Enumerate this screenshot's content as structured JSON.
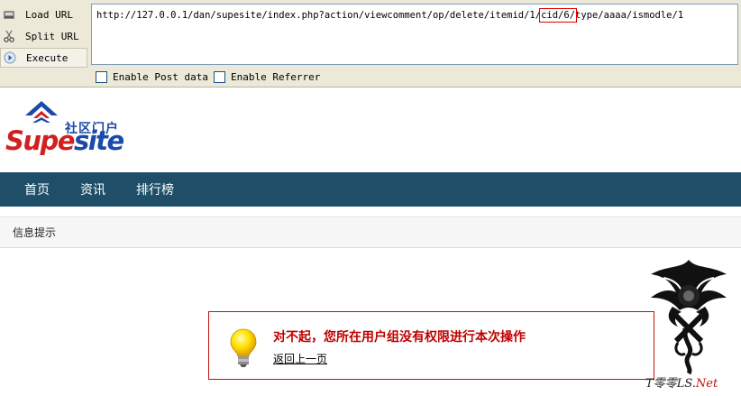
{
  "hackbar": {
    "buttons": {
      "load_url": "Load URL",
      "split_url": "Split URL",
      "execute": "Execute"
    },
    "url": {
      "prefix": "http://127.0.0.1/dan/supesite/index.php?action/viewcomment/op/delete/itemid/1/",
      "highlight": "cid/6/",
      "suffix": "type/aaaa/ismodle/1"
    },
    "options": {
      "enable_post": "Enable Post data",
      "enable_referrer": "Enable Referrer"
    },
    "highlight_color": "#e00000"
  },
  "logo": {
    "chinese": "社区门户",
    "word_part1": "Supe",
    "word_part2": "site",
    "brand_red": "#d21f1f",
    "brand_blue": "#1b4aa8"
  },
  "nav": {
    "items": [
      "首页",
      "资讯",
      "排行榜"
    ],
    "bg_color": "#1f4f68"
  },
  "info_bar": {
    "title": "信息提示"
  },
  "message": {
    "text": "对不起，您所在用户组没有权限进行本次操作",
    "back_link": "返回上一页",
    "icon": "lightbulb-icon",
    "border_color": "#c21010"
  },
  "watermark": {
    "part1": "T",
    "part2": "零零",
    "part3": "LS.",
    "part4": "Net"
  }
}
